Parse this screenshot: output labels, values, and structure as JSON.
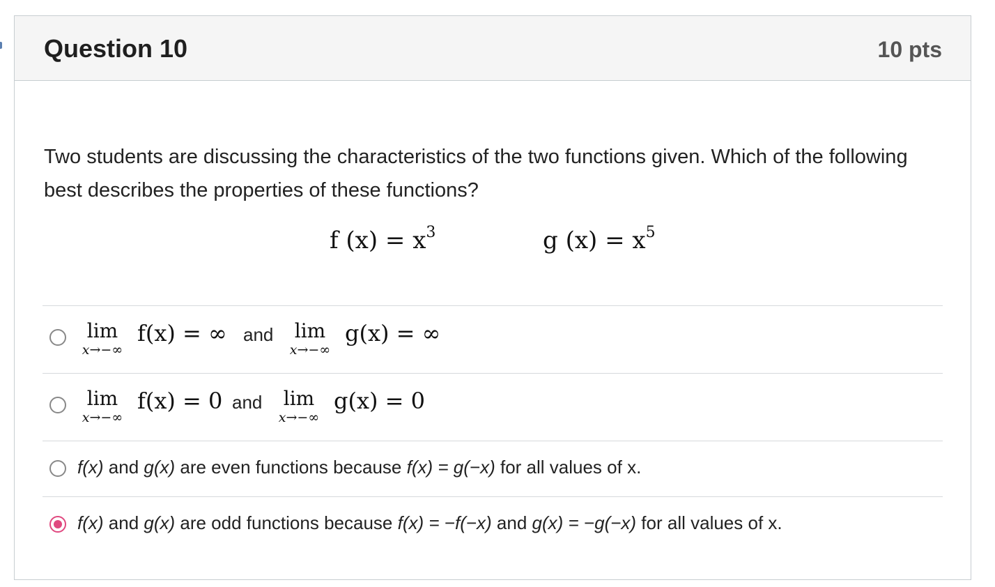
{
  "question": {
    "title": "Question 10",
    "points": "10 pts",
    "prompt": "Two students are discussing the characteristics of the two functions given. Which of the following best describes the properties of these functions?",
    "formula_f": "f (x) = x",
    "formula_f_exp": "3",
    "formula_g": "g (x) = x",
    "formula_g_exp": "5"
  },
  "answers": [
    {
      "lim_word": "lim",
      "lim_sub": "x→−∞",
      "f_expr": "f(x) = ∞",
      "and": "and",
      "g_expr": "g(x) = ∞",
      "selected": false
    },
    {
      "lim_word": "lim",
      "lim_sub": "x→−∞",
      "f_expr": "f(x) = 0",
      "and": "and",
      "g_expr": "g(x) = 0",
      "selected": false
    },
    {
      "text_a": "f(x)",
      "text_b": " and ",
      "text_c": "g(x)",
      "text_d": " are even functions because ",
      "text_e": "f(x) = g(−x)",
      "text_f": " for all values of x.",
      "selected": false
    },
    {
      "text_a": "f(x)",
      "text_b": " and ",
      "text_c": "g(x)",
      "text_d": " are odd functions because ",
      "text_e": "f(x) = −f(−x)",
      "text_f": " and ",
      "text_g": "g(x) = −g(−x)",
      "text_h": " for all values of x.",
      "selected": true
    }
  ],
  "colors": {
    "accent": "#e0487f",
    "header_bg": "#f5f5f5",
    "border": "#c7cdd1"
  }
}
